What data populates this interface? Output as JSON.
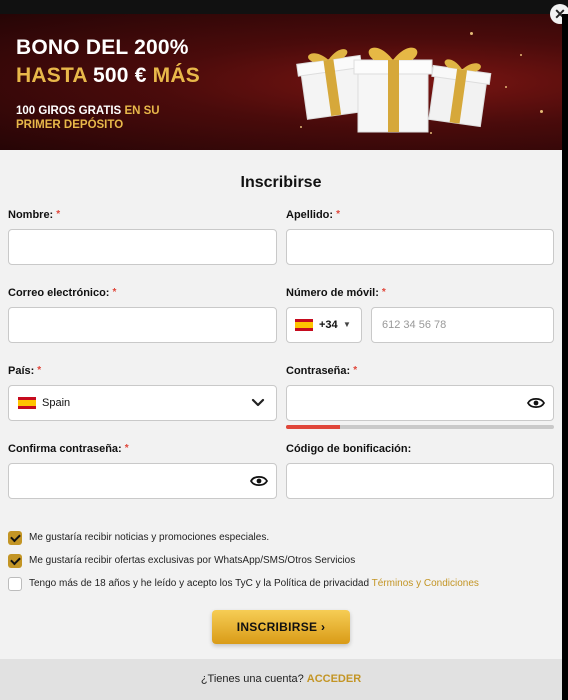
{
  "banner": {
    "line1": "BONO DEL 200%",
    "line2_a": "HASTA",
    "line2_b": "500 €",
    "line2_c": "MÁS",
    "line3_a": "100 GIROS GRATIS",
    "line3_b": "EN SU",
    "line3_c": "PRIMER DEPÓSITO"
  },
  "close_label": "✕",
  "title": "Inscribirse",
  "required_mark": "*",
  "fields": {
    "nombre": {
      "label": "Nombre:"
    },
    "apellido": {
      "label": "Apellido:"
    },
    "correo": {
      "label": "Correo electrónico:"
    },
    "movil": {
      "label": "Número de móvil:",
      "prefix": "+34",
      "placeholder": "612 34 56 78"
    },
    "pais": {
      "label": "País:",
      "value": "Spain"
    },
    "contrasena": {
      "label": "Contraseña:",
      "strength": 0.2
    },
    "confirma": {
      "label": "Confirma contraseña:"
    },
    "codigo": {
      "label": "Código de bonificación:"
    }
  },
  "checkboxes": [
    {
      "text": "Me gustaría recibir noticias y promociones especiales.",
      "checked": true
    },
    {
      "text": "Me gustaría recibir ofertas exclusivas por WhatsApp/SMS/Otros Servicios",
      "checked": true
    },
    {
      "text": "Tengo más de 18 años y he leído y acepto los TyC y la Política de privacidad",
      "link": "Términos y Condiciones",
      "checked": false
    }
  ],
  "submit_label": "INSCRIBIRSE",
  "footer": {
    "question": "¿Tienes una cuenta?",
    "link": "ACCEDER"
  },
  "colors": {
    "accent": "#c39525",
    "error": "#e0463a",
    "banner": "#4a0b0b"
  },
  "icons": [
    "close-icon",
    "gift-icon",
    "spain-flag-icon",
    "chevron-down-icon",
    "eye-icon",
    "chevron-right-icon"
  ]
}
